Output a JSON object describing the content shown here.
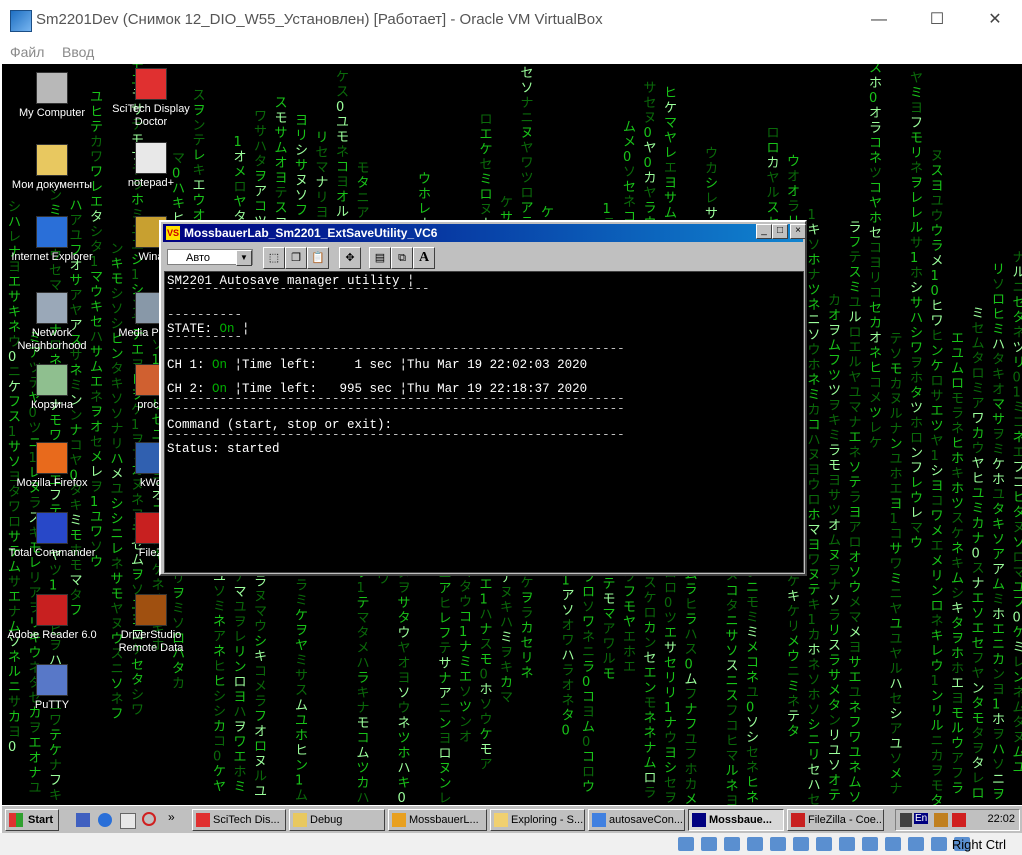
{
  "host": {
    "title": "Sm2201Dev (Снимок 12_DIO_W55_Установлен) [Работает] - Oracle VM VirtualBox",
    "menu": [
      "Файл",
      "Ввод"
    ],
    "controls": {
      "minimize": "—",
      "maximize": "☐",
      "close": "✕"
    }
  },
  "desktop": {
    "icons": [
      {
        "label": "My Computer",
        "color": "#b8b8b8"
      },
      {
        "label": "Мои документы",
        "color": "#e8c860"
      },
      {
        "label": "Internet Explorer",
        "color": "#2a6fd8"
      },
      {
        "label": "Network Neighborhood",
        "color": "#9aa8b8"
      },
      {
        "label": "Корзина",
        "color": "#8fbf8f"
      },
      {
        "label": "Mozilla Firefox",
        "color": "#e86a1c"
      },
      {
        "label": "Total Commander",
        "color": "#2848c8"
      },
      {
        "label": "Adobe Reader 6.0",
        "color": "#c82020"
      },
      {
        "label": "PuTTY",
        "color": "#5878c8"
      },
      {
        "label": "SciTech Display Doctor",
        "color": "#e03030"
      },
      {
        "label": "notepad+",
        "color": "#e8e8e8"
      },
      {
        "label": "Wina",
        "color": "#c8a030"
      },
      {
        "label": "Media P Clas",
        "color": "#8898a8"
      },
      {
        "label": "proce",
        "color": "#d06030"
      },
      {
        "label": "kWd",
        "color": "#3060b0"
      },
      {
        "label": "FileZ",
        "color": "#c82020"
      },
      {
        "label": "DriverStudio Remote Data",
        "color": "#a05010"
      }
    ]
  },
  "vc6": {
    "title": "MossbauerLab_Sm2201_ExtSaveUtility_VC6",
    "icon_text": "VS",
    "buttons": {
      "minimize": "_",
      "maximize": "□",
      "close": "×"
    },
    "font_select": "Авто",
    "font_arrow": "▼",
    "toolbar": [
      "⬚",
      "❐",
      "📋",
      "✥",
      "▤",
      "⧉",
      "A"
    ],
    "console": {
      "header": "SM2201 Autosave manager utility ¦",
      "rule_short": "-----------------------------------",
      "rule_state": "----------",
      "state_prefix": "STATE: ",
      "state_value": "On",
      "state_suffix": " ¦",
      "rule_long": "-------------------------------------------------------------",
      "ch1_prefix": "CH 1: ",
      "ch1_state": "On",
      "ch1_suffix": " ¦Time left:     1 sec ¦Thu Mar 19 22:02:03 2020",
      "ch2_prefix": "CH 2: ",
      "ch2_state": "On",
      "ch2_suffix": " ¦Time left:   995 sec ¦Thu Mar 19 22:18:37 2020",
      "command": "Command (start, stop or exit):",
      "status": "Status: started"
    }
  },
  "taskbar": {
    "start": "Start",
    "quicklaunch_arrow": "»",
    "buttons": [
      {
        "label": "SciTech Dis...",
        "color": "#e03030",
        "active": false
      },
      {
        "label": "Debug",
        "color": "#e8c860",
        "active": false
      },
      {
        "label": "MossbauerL...",
        "color": "#e8a020",
        "active": false
      },
      {
        "label": "Exploring - S...",
        "color": "#f0d070",
        "active": false
      },
      {
        "label": "autosaveCon...",
        "color": "#4080e0",
        "active": false
      },
      {
        "label": "Mossbaue...",
        "color": "#000080",
        "active": true
      },
      {
        "label": "FileZilla - Coe...",
        "color": "#c82020",
        "active": false
      }
    ],
    "tray_lang": "En",
    "clock": "22:02"
  },
  "statusbar": {
    "host_key": "Right Ctrl"
  }
}
